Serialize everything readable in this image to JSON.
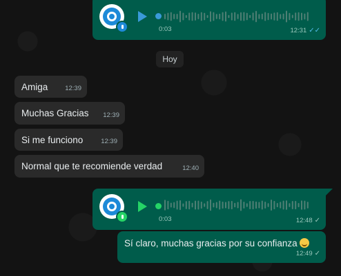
{
  "date_chip": "Hoy",
  "voice_messages": [
    {
      "duration": "0:03",
      "time": "12:31",
      "status": "read",
      "accent": "#3a9ad9"
    },
    {
      "duration": "0:03",
      "time": "12:48",
      "status": "sent",
      "accent": "#25d366"
    }
  ],
  "incoming": [
    {
      "text": "Amiga",
      "time": "12:39"
    },
    {
      "text": "Muchas Gracias",
      "time": "12:39"
    },
    {
      "text": "Si me funciono",
      "time": "12:39"
    },
    {
      "text": "Normal que te recomiende verdad",
      "time": "12:40"
    }
  ],
  "outgoing_text": {
    "text": "Sí claro, muchas gracias por su confianza",
    "emoji": "grinning-face-icon",
    "time": "12:49",
    "status": "sent"
  },
  "colors": {
    "incoming_bubble": "#2a2a2a",
    "outgoing_bubble": "#005c4b",
    "read_tick": "#53bdeb",
    "background": "#131313"
  }
}
